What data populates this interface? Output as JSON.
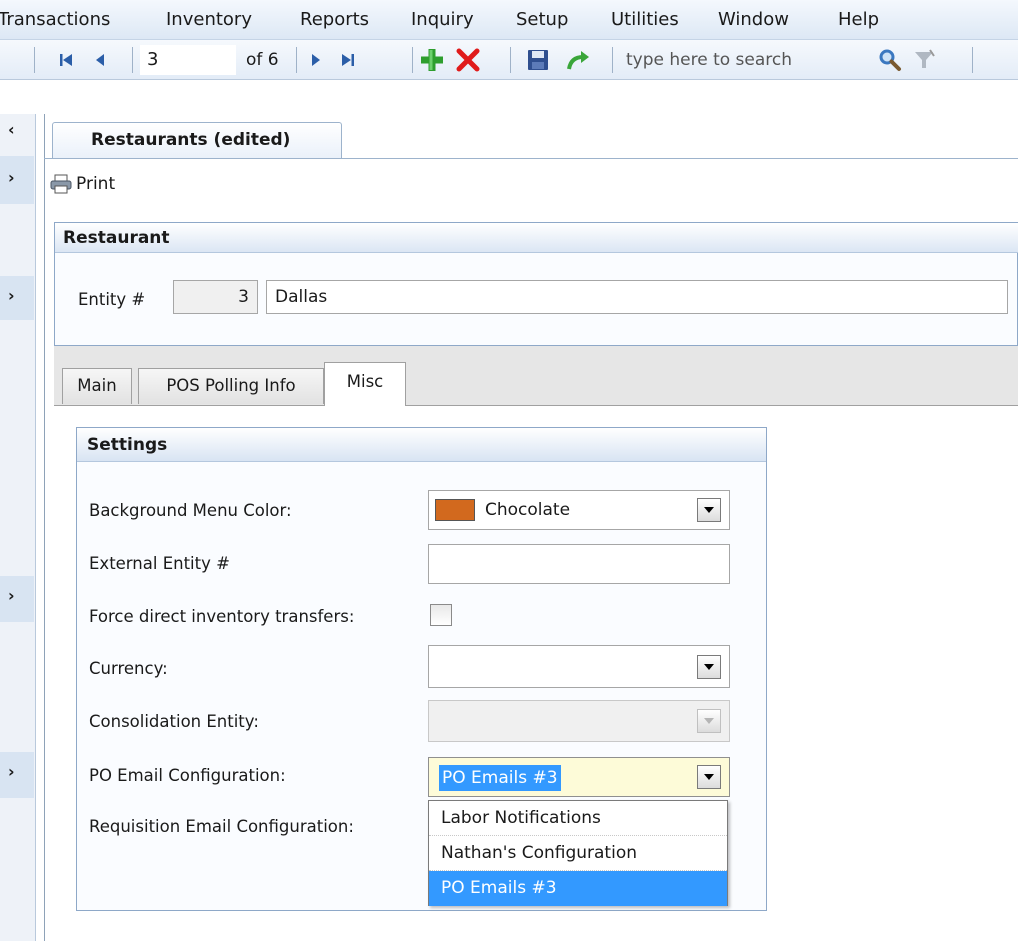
{
  "menubar": {
    "items": [
      "Transactions",
      "Inventory",
      "Reports",
      "Inquiry",
      "Setup",
      "Utilities",
      "Window",
      "Help"
    ]
  },
  "toolbar": {
    "record_value": "3",
    "record_of": "of 6",
    "search_placeholder": "type here to search",
    "icons": [
      "first-record-icon",
      "prev-record-icon",
      "next-record-icon",
      "last-record-icon",
      "add-icon",
      "delete-icon",
      "save-icon",
      "undo-icon",
      "search-icon",
      "filter-icon"
    ],
    "colors": {
      "add": "#2e9e2e",
      "delete": "#e01b1b",
      "save": "#2f4f8f",
      "undo": "#3aa63a"
    }
  },
  "document": {
    "tab_title": "Restaurants (edited)",
    "print_label": "Print"
  },
  "restaurant": {
    "section_title": "Restaurant",
    "entity_label": "Entity #",
    "entity_number": "3",
    "entity_name": "Dallas"
  },
  "tabs": {
    "items": [
      "Main",
      "POS Polling Info",
      "Misc"
    ],
    "active": "Misc"
  },
  "settings": {
    "section_title": "Settings",
    "background_color_label": "Background Menu Color:",
    "background_color_value": "Chocolate",
    "background_color_swatch": "#d2691e",
    "external_entity_label": "External Entity #",
    "external_entity_value": "",
    "force_transfers_label": "Force direct inventory transfers:",
    "force_transfers_checked": false,
    "currency_label": "Currency:",
    "currency_value": "",
    "consolidation_label": "Consolidation Entity:",
    "consolidation_value": "",
    "po_email_label": "PO Email Configuration:",
    "po_email_value": "PO Emails #3",
    "requisition_email_label": "Requisition Email Configuration:",
    "po_email_options": [
      "Labor Notifications",
      "Nathan's Configuration",
      "PO Emails #3"
    ],
    "po_email_selected": "PO Emails #3",
    "selection_color": "#3399ff"
  }
}
